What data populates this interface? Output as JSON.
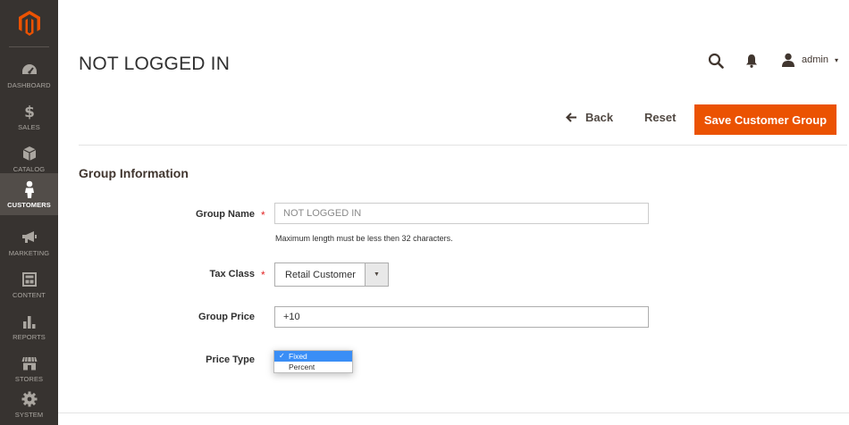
{
  "sidebar": {
    "logo_icon": "magento-logo-icon",
    "items": [
      {
        "label": "DASHBOARD",
        "icon": "gauge-icon",
        "active": false
      },
      {
        "label": "SALES",
        "icon": "dollar-icon",
        "active": false
      },
      {
        "label": "CATALOG",
        "icon": "cube-icon",
        "active": false
      },
      {
        "label": "CUSTOMERS",
        "icon": "person-icon",
        "active": true
      },
      {
        "label": "MARKETING",
        "icon": "megaphone-icon",
        "active": false
      },
      {
        "label": "CONTENT",
        "icon": "layout-icon",
        "active": false
      },
      {
        "label": "REPORTS",
        "icon": "bar-chart-icon",
        "active": false
      },
      {
        "label": "STORES",
        "icon": "storefront-icon",
        "active": false
      },
      {
        "label": "SYSTEM",
        "icon": "gear-icon",
        "active": false
      }
    ]
  },
  "header": {
    "title": "NOT LOGGED IN",
    "user": "admin",
    "caret": "▾"
  },
  "actions": {
    "back_label": "Back",
    "reset_label": "Reset",
    "save_label": "Save Customer Group"
  },
  "section": {
    "title": "Group Information"
  },
  "form": {
    "group_name": {
      "label": "Group Name",
      "required_mark": "*",
      "value": "NOT LOGGED IN",
      "note": "Maximum length must be less then 32 characters."
    },
    "tax_class": {
      "label": "Tax Class",
      "required_mark": "*",
      "value": "Retail Customer"
    },
    "group_price": {
      "label": "Group Price",
      "value": "+10"
    },
    "price_type": {
      "label": "Price Type",
      "options": [
        "Fixed",
        "Percent"
      ],
      "selected": "Fixed",
      "check": "✓"
    }
  },
  "colors": {
    "sidebar_bg": "#373330",
    "sidebar_active": "#524d49",
    "accent": "#eb5202",
    "required": "#e22626",
    "option_highlight": "#3a8ef6"
  }
}
